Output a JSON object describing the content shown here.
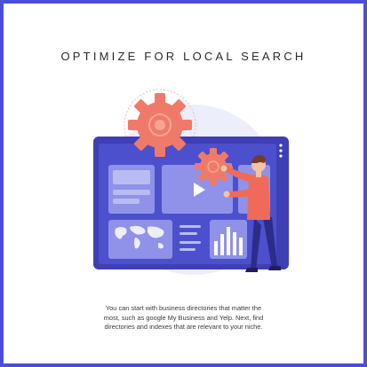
{
  "card": {
    "title": "OPTIMIZE FOR LOCAL SEARCH",
    "body_lines": [
      "You can start with business directories that matter the",
      "most, such as google My Business and Yelp. Next, find",
      "directories and indexes that are relevant to your niche."
    ],
    "accent_color": "#4b4fd6"
  },
  "illustration": {
    "colors": {
      "screen_frame": "#3f3fb5",
      "screen_dark": "#2e2e8f",
      "panel": "#8f92e8",
      "panel_light": "#b9bcf2",
      "gear": "#f07a6a",
      "person_shirt": "#f06a5a",
      "person_pants": "#2c2c8a",
      "hair": "#7a3a2a",
      "skin": "#f4c2a4",
      "backdrop": "#e9eaf9"
    },
    "icons": [
      "gear-icon",
      "play-icon",
      "world-map-icon",
      "bar-chart-icon",
      "kebab-menu-icon"
    ]
  }
}
